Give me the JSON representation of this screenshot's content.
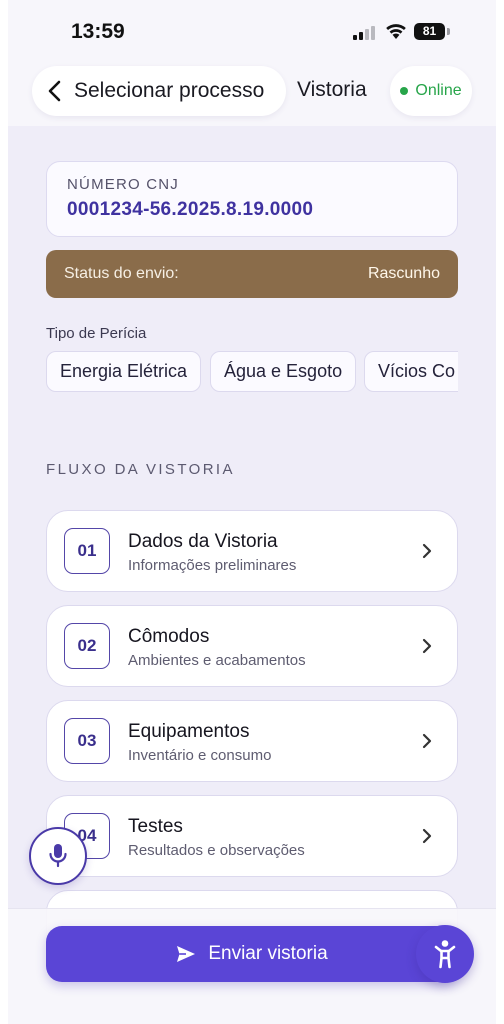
{
  "status_bar": {
    "time": "13:59",
    "battery": "81"
  },
  "header": {
    "back_label": "Selecionar processo",
    "title": "Vistoria",
    "online_label": "Online"
  },
  "cnj": {
    "label": "NÚMERO CNJ",
    "value": "0001234-56.2025.8.19.0000"
  },
  "envio": {
    "label": "Status do envio:",
    "value": "Rascunho"
  },
  "pericia": {
    "label": "Tipo de Perícia",
    "options": [
      "Energia Elétrica",
      "Água e Esgoto",
      "Vícios Co"
    ]
  },
  "fluxo": {
    "label": "FLUXO DA VISTORIA",
    "steps": [
      {
        "num": "01",
        "title": "Dados da Vistoria",
        "subtitle": "Informações preliminares"
      },
      {
        "num": "02",
        "title": "Cômodos",
        "subtitle": "Ambientes e acabamentos"
      },
      {
        "num": "03",
        "title": "Equipamentos",
        "subtitle": "Inventário e consumo"
      },
      {
        "num": "04",
        "title": "Testes",
        "subtitle": "Resultados e observações"
      }
    ]
  },
  "actions": {
    "send_label": "Enviar vistoria"
  },
  "icons": {
    "back": "chevron-left-icon",
    "mic": "microphone-icon",
    "send": "paper-plane-icon",
    "accessibility": "accessibility-icon",
    "chevron": "chevron-right-icon"
  },
  "colors": {
    "accent": "#5a45d6",
    "status": "#8a6c4a",
    "online": "#27a54a"
  }
}
